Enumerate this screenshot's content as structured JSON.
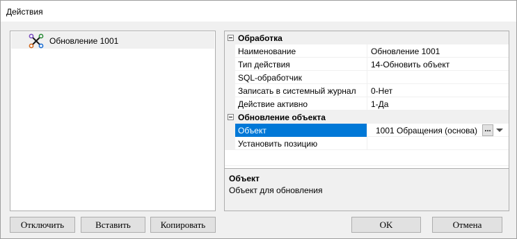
{
  "window": {
    "title": "Действия"
  },
  "tree": {
    "items": [
      {
        "label": "Обновление 1001",
        "icon": "action-node-icon"
      }
    ]
  },
  "properties": {
    "categories": [
      {
        "label": "Обработка",
        "rows": [
          {
            "name": "Наименование",
            "value": "Обновление 1001"
          },
          {
            "name": "Тип действия",
            "value": "14-Обновить объект"
          },
          {
            "name": "SQL-обработчик",
            "value": ""
          },
          {
            "name": "Записать в системный журнал",
            "value": "0-Нет"
          },
          {
            "name": "Действие активно",
            "value": "1-Да"
          }
        ]
      },
      {
        "label": "Обновление объекта",
        "rows": [
          {
            "name": "Объект",
            "value": "1001 Обращения (основа)",
            "ellipsis": "..."
          },
          {
            "name": "Установить позицию",
            "value": ""
          }
        ]
      }
    ]
  },
  "description": {
    "title": "Объект",
    "text": "Объект для обновления"
  },
  "buttons": {
    "disable": "Отключить",
    "insert": "Вставить",
    "copy": "Копировать",
    "ok": "OK",
    "cancel": "Отмена"
  },
  "colors": {
    "selection": "#0078d7",
    "background": "#f0f0f0"
  }
}
